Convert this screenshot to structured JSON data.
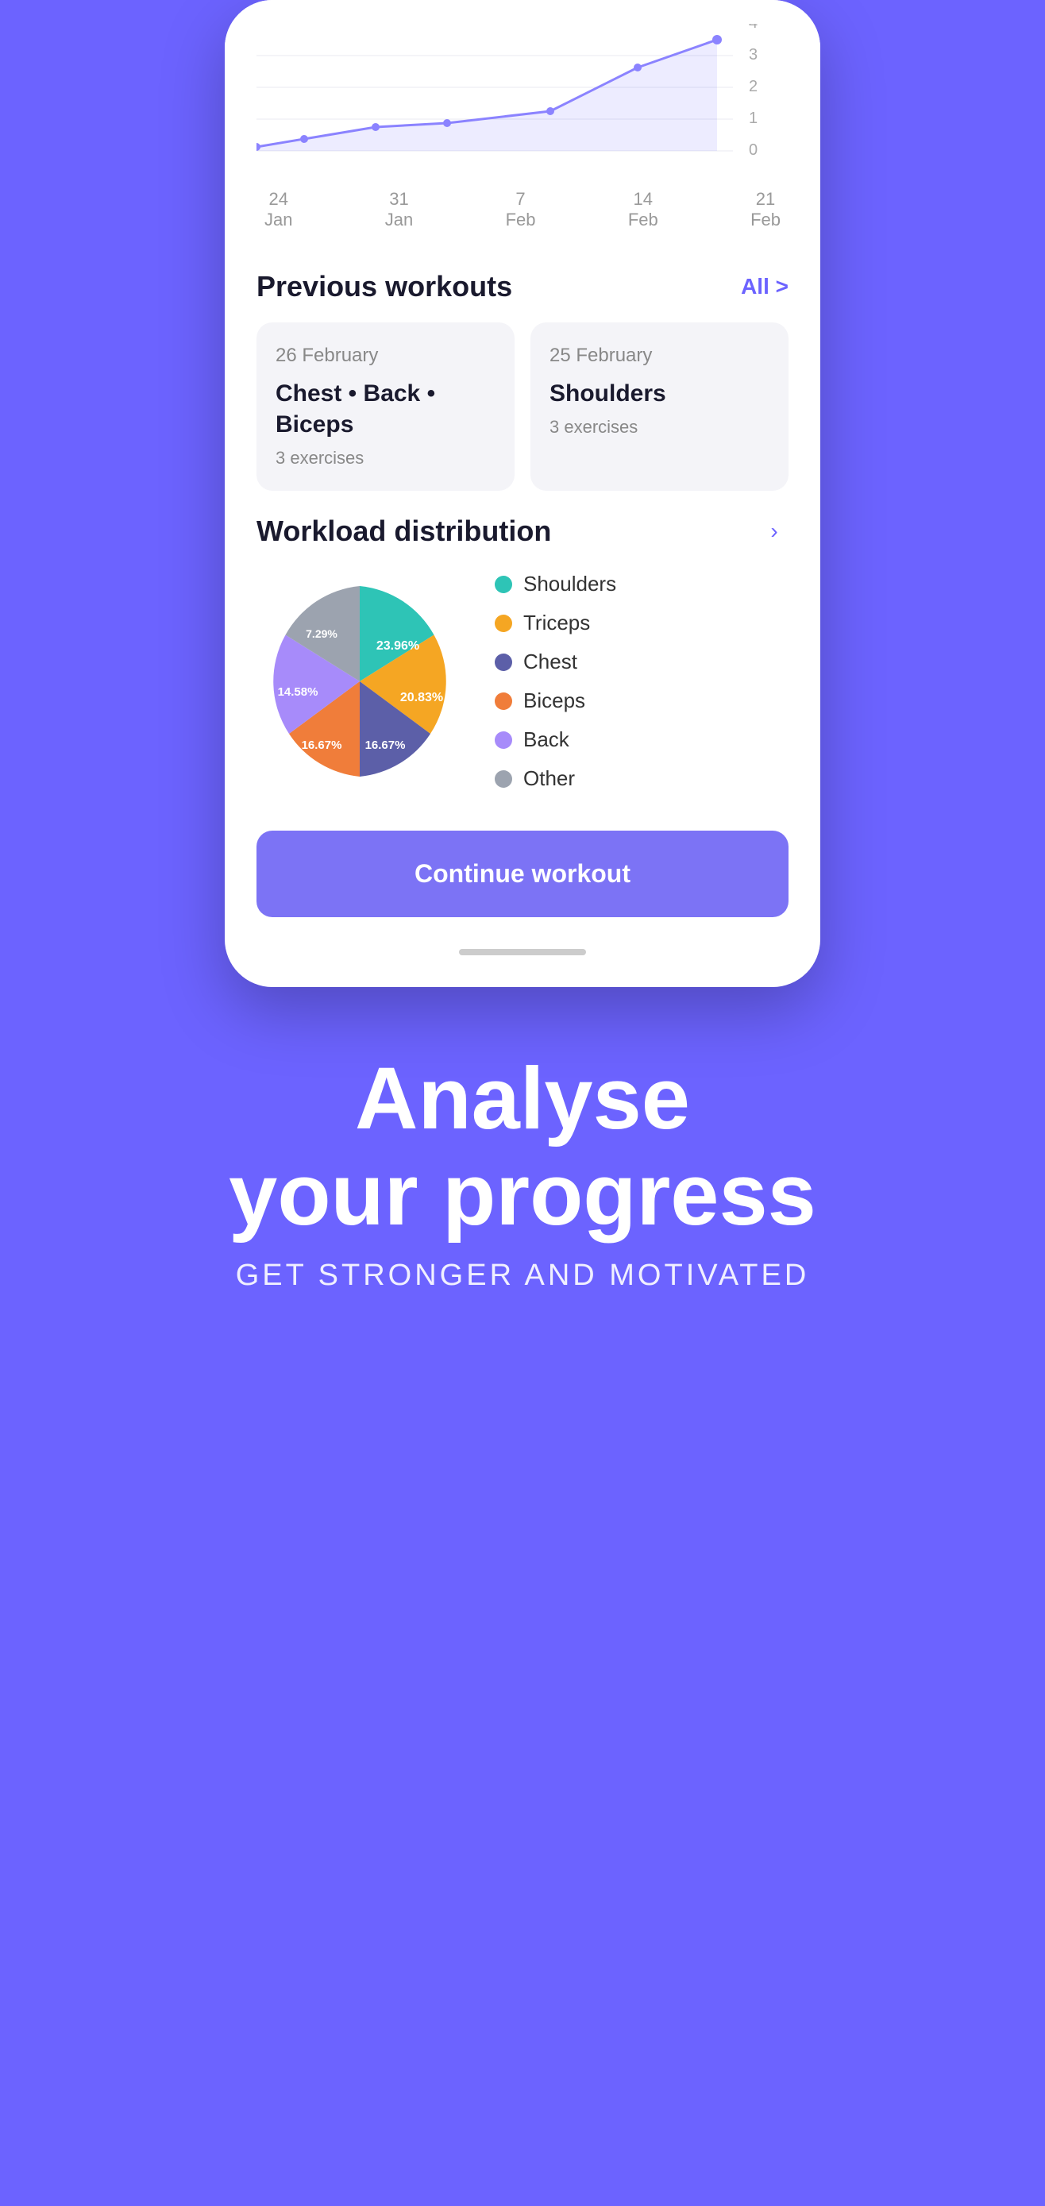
{
  "colors": {
    "bg": "#6c63ff",
    "phone_bg": "#ffffff",
    "card_bg": "#f4f4f8",
    "accent": "#7c73f5",
    "text_dark": "#1a1a2e",
    "text_muted": "#888",
    "pie_shoulders": "#2ec4b6",
    "pie_triceps": "#f5a623",
    "pie_chest": "#5c5fa8",
    "pie_biceps": "#f07d3a",
    "pie_back": "#a78bfa",
    "pie_other": "#9ca3af"
  },
  "chart": {
    "x_labels": [
      {
        "line1": "24",
        "line2": "Jan"
      },
      {
        "line1": "31",
        "line2": "Jan"
      },
      {
        "line1": "7",
        "line2": "Feb"
      },
      {
        "line1": "14",
        "line2": "Feb"
      },
      {
        "line1": "21",
        "line2": "Feb"
      }
    ],
    "y_max": 5
  },
  "previous_workouts": {
    "section_title": "Previous workouts",
    "link_label": "All >",
    "cards": [
      {
        "date": "26 February",
        "name": "Chest • Back • Biceps",
        "exercises": "3 exercises"
      },
      {
        "date": "25 February",
        "name": "Shoulders",
        "exercises": "3 exercises"
      }
    ]
  },
  "workload_distribution": {
    "section_title": "Workload distribution",
    "segments": [
      {
        "label": "Shoulders",
        "percent": 23.96,
        "color": "#2ec4b6"
      },
      {
        "label": "Triceps",
        "percent": 20.83,
        "color": "#f5a623"
      },
      {
        "label": "Chest",
        "percent": 16.67,
        "color": "#5c5fa8"
      },
      {
        "label": "Biceps",
        "percent": 16.67,
        "color": "#f07d3a"
      },
      {
        "label": "Back",
        "percent": 14.58,
        "color": "#a78bfa"
      },
      {
        "label": "Other",
        "percent": 7.29,
        "color": "#9ca3af"
      }
    ]
  },
  "continue_button": {
    "label": "Continue workout"
  },
  "bottom_section": {
    "title_line1": "Analyse",
    "title_line2": "your progress",
    "subtitle": "GET STRONGER AND MOTIVATED"
  }
}
